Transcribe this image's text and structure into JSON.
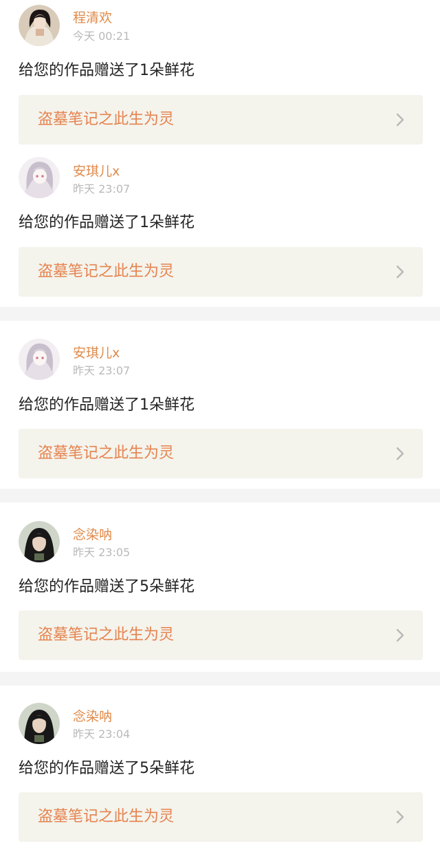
{
  "notifications": [
    {
      "user": "程清欢",
      "time": "今天 00:21",
      "message": "给您的作品赠送了1朵鲜花",
      "work_title": "盗墓笔记之此生为灵",
      "avatar": "user-avatar-1"
    },
    {
      "user": "安琪儿x",
      "time": "昨天 23:07",
      "message": "给您的作品赠送了1朵鲜花",
      "work_title": "盗墓笔记之此生为灵",
      "avatar": "user-avatar-2"
    },
    {
      "user": "安琪儿x",
      "time": "昨天 23:07",
      "message": "给您的作品赠送了1朵鲜花",
      "work_title": "盗墓笔记之此生为灵",
      "avatar": "user-avatar-2"
    },
    {
      "user": "念染呐",
      "time": "昨天 23:05",
      "message": "给您的作品赠送了5朵鲜花",
      "work_title": "盗墓笔记之此生为灵",
      "avatar": "user-avatar-3"
    },
    {
      "user": "念染呐",
      "time": "昨天 23:04",
      "message": "给您的作品赠送了5朵鲜花",
      "work_title": "盗墓笔记之此生为灵",
      "avatar": "user-avatar-3"
    }
  ],
  "colors": {
    "page_background": "#f4f4f4",
    "card_background": "#ffffff",
    "username": "#e08a4a",
    "timestamp": "#b9b9b9",
    "message": "#222222",
    "link_background": "#f4f3ec",
    "link_text": "#e5834e",
    "chevron": "#b7b7b7"
  }
}
